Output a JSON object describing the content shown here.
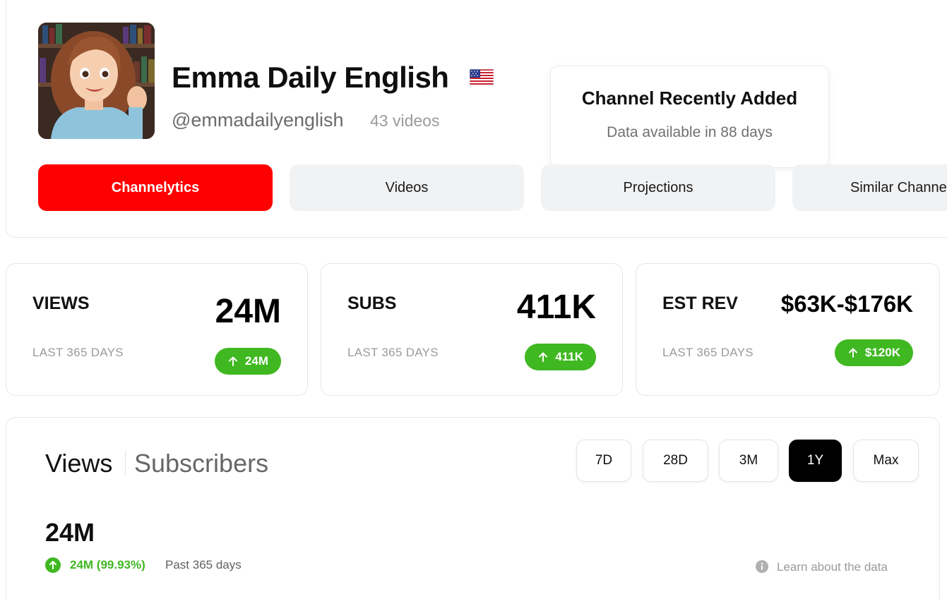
{
  "channel": {
    "name": "Emma Daily English",
    "handle": "@emmadailyenglish",
    "video_count": "43 videos",
    "flag": "us-flag-icon"
  },
  "notice": {
    "title": "Channel Recently Added",
    "subtitle": "Data available in 88 days"
  },
  "tabs": [
    {
      "label": "Channelytics",
      "active": true
    },
    {
      "label": "Videos",
      "active": false
    },
    {
      "label": "Projections",
      "active": false
    },
    {
      "label": "Similar Channels",
      "active": false
    }
  ],
  "stats": [
    {
      "label": "VIEWS",
      "value": "24M",
      "period": "LAST 365 DAYS",
      "change": "24M"
    },
    {
      "label": "SUBS",
      "value": "411K",
      "period": "LAST 365 DAYS",
      "change": "411K"
    },
    {
      "label": "EST REV",
      "value": "$63K-$176K",
      "period": "LAST 365 DAYS",
      "change": "$120K"
    }
  ],
  "chart": {
    "tabs": [
      "Views",
      "Subscribers"
    ],
    "ranges": [
      {
        "label": "7D",
        "active": false
      },
      {
        "label": "28D",
        "active": false
      },
      {
        "label": "3M",
        "active": false
      },
      {
        "label": "1Y",
        "active": true
      },
      {
        "label": "Max",
        "active": false
      }
    ],
    "total": "24M",
    "change": "24M (99.93%)",
    "period": "Past 365 days",
    "learn_link": "Learn about the data"
  },
  "colors": {
    "accent": "#ff0000",
    "positive": "#3fb821"
  }
}
